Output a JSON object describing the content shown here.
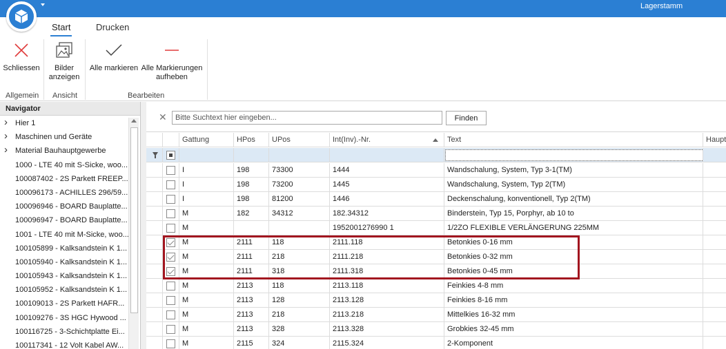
{
  "window": {
    "title": "Lagerstamm"
  },
  "ribbon": {
    "tabs": [
      {
        "label": "Start",
        "active": true
      },
      {
        "label": "Drucken",
        "active": false
      }
    ],
    "buttons": {
      "close": "Schliessen",
      "show_images": "Bilder\nanzeigen",
      "mark_all": "Alle markieren",
      "unmark_all": "Alle Markierungen\naufheben"
    },
    "groups": {
      "general": "Allgemein",
      "view": "Ansicht",
      "edit": "Bearbeiten"
    }
  },
  "navigator": {
    "title": "Navigator",
    "items": [
      {
        "label": "Hier 1",
        "expandable": true
      },
      {
        "label": "Maschinen und Geräte",
        "expandable": true
      },
      {
        "label": "Material Bauhauptgewerbe",
        "expandable": true
      },
      {
        "label": "1000 - LTE 40 mit S-Sicke, woo...",
        "expandable": false
      },
      {
        "label": "100087402 - 2S Parkett FREEP...",
        "expandable": false
      },
      {
        "label": "100096173 - ACHILLES 296/59...",
        "expandable": false
      },
      {
        "label": "100096946 - BOARD Bauplatte...",
        "expandable": false
      },
      {
        "label": "100096947 - BOARD Bauplatte...",
        "expandable": false
      },
      {
        "label": "1001 - LTE 40 mit M-Sicke, woo...",
        "expandable": false
      },
      {
        "label": "100105899 - Kalksandstein K 1...",
        "expandable": false
      },
      {
        "label": "100105940 - Kalksandstein K 1...",
        "expandable": false
      },
      {
        "label": "100105943 - Kalksandstein K 1...",
        "expandable": false
      },
      {
        "label": "100105952 - Kalksandstein K 1...",
        "expandable": false
      },
      {
        "label": "100109013 - 2S Parkett HAFR...",
        "expandable": false
      },
      {
        "label": "100109276 - 3S HGC Hywood ...",
        "expandable": false
      },
      {
        "label": "100116725 - 3-Schichtplatte Ei...",
        "expandable": false
      },
      {
        "label": "100117341 - 12 Volt Kabel AW...",
        "expandable": false
      }
    ]
  },
  "search": {
    "placeholder": "Bitte Suchtext hier eingeben...",
    "value": "",
    "button": "Finden"
  },
  "grid": {
    "columns": [
      "Gattung",
      "HPos",
      "UPos",
      "Int(Inv).-Nr.",
      "Text",
      "Haupt"
    ],
    "sorted_column": "Int(Inv).-Nr.",
    "rows": [
      {
        "checked": false,
        "gattung": "I",
        "hpos": "198",
        "upos": "73300",
        "nr": "1444",
        "text": "Wandschalung, System, Typ 3-1(TM)"
      },
      {
        "checked": false,
        "gattung": "I",
        "hpos": "198",
        "upos": "73200",
        "nr": "1445",
        "text": "Wandschalung, System, Typ 2(TM)"
      },
      {
        "checked": false,
        "gattung": "I",
        "hpos": "198",
        "upos": "81200",
        "nr": "1446",
        "text": "Deckenschalung, konventionell, Typ 2(TM)"
      },
      {
        "checked": false,
        "gattung": "M",
        "hpos": "182",
        "upos": "34312",
        "nr": "182.34312",
        "text": "Binderstein, Typ 15, Porphyr, ab 10 to"
      },
      {
        "checked": false,
        "gattung": "M",
        "hpos": "",
        "upos": "",
        "nr": "1952001276990 1",
        "text": "1/2ZO FLEXIBLE VERLÄNGERUNG 225MM"
      },
      {
        "checked": true,
        "gattung": "M",
        "hpos": "2111",
        "upos": "118",
        "nr": "2111.118",
        "text": "Betonkies 0-16 mm"
      },
      {
        "checked": true,
        "gattung": "M",
        "hpos": "2111",
        "upos": "218",
        "nr": "2111.218",
        "text": "Betonkies 0-32 mm"
      },
      {
        "checked": true,
        "gattung": "M",
        "hpos": "2111",
        "upos": "318",
        "nr": "2111.318",
        "text": "Betonkies 0-45 mm"
      },
      {
        "checked": false,
        "gattung": "M",
        "hpos": "2113",
        "upos": "118",
        "nr": "2113.118",
        "text": "Feinkies 4-8 mm"
      },
      {
        "checked": false,
        "gattung": "M",
        "hpos": "2113",
        "upos": "128",
        "nr": "2113.128",
        "text": "Feinkies 8-16 mm"
      },
      {
        "checked": false,
        "gattung": "M",
        "hpos": "2113",
        "upos": "218",
        "nr": "2113.218",
        "text": "Mittelkies 16-32 mm"
      },
      {
        "checked": false,
        "gattung": "M",
        "hpos": "2113",
        "upos": "328",
        "nr": "2113.328",
        "text": "Grobkies 32-45 mm"
      },
      {
        "checked": false,
        "gattung": "M",
        "hpos": "2115",
        "upos": "324",
        "nr": "2115.324",
        "text": "2-Komponent"
      }
    ]
  },
  "colors": {
    "titlebar": "#2b7fd3",
    "highlight": "#a2151f",
    "filter_row": "#dce9f5",
    "close_icon": "#e03c3c",
    "unmark_icon": "#e03c3c"
  }
}
